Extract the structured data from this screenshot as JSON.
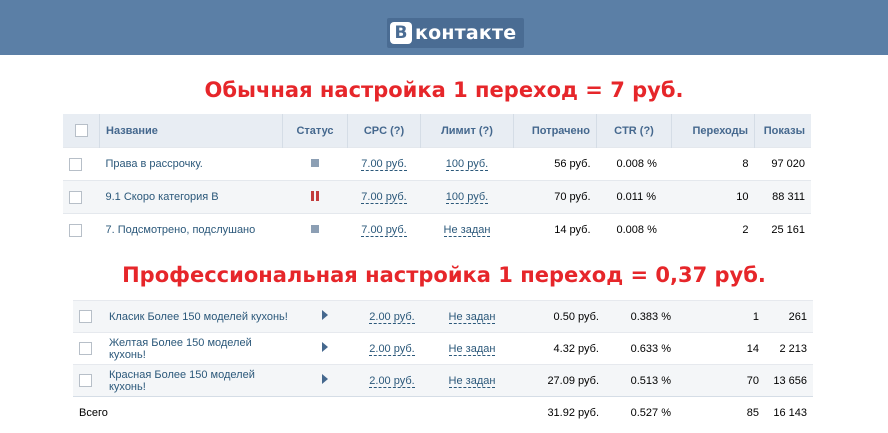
{
  "header": {
    "logo_mark": "В",
    "logo_text": "контакте"
  },
  "captions": {
    "first": "Обычная настройка 1 переход  =  7 руб.",
    "second": "Профессиональная настройка 1 переход = 0,37 руб."
  },
  "table1": {
    "columns": [
      "Название",
      "Статус",
      "CPC (?)",
      "Лимит (?)",
      "Потрачено",
      "CTR (?)",
      "Переходы",
      "Показы"
    ],
    "rows": [
      {
        "name": "Права в рассрочку.",
        "status": "stopped",
        "cpc": "7.00 руб.",
        "limit": "100 руб.",
        "spent": "56 руб.",
        "ctr": "0.008 %",
        "clicks": "8",
        "views": "97 020"
      },
      {
        "name": "9.1 Скоро категория В",
        "status": "paused",
        "cpc": "7.00 руб.",
        "limit": "100 руб.",
        "spent": "70 руб.",
        "ctr": "0.011 %",
        "clicks": "10",
        "views": "88 311"
      },
      {
        "name": "7. Подсмотрено, подслушано",
        "status": "stopped",
        "cpc": "7.00 руб.",
        "limit": "Не задан",
        "spent": "14 руб.",
        "ctr": "0.008 %",
        "clicks": "2",
        "views": "25 161"
      }
    ]
  },
  "table2": {
    "rows": [
      {
        "name": "Класик Более 150 моделей кухонь!",
        "cpc": "2.00 руб.",
        "limit": "Не задан",
        "spent": "0.50 руб.",
        "ctr": "0.383 %",
        "clicks": "1",
        "views": "261"
      },
      {
        "name": "Желтая Более 150 моделей кухонь!",
        "cpc": "2.00 руб.",
        "limit": "Не задан",
        "spent": "4.32 руб.",
        "ctr": "0.633 %",
        "clicks": "14",
        "views": "2 213"
      },
      {
        "name": "Красная Более 150 моделей кухонь!",
        "cpc": "2.00 руб.",
        "limit": "Не задан",
        "spent": "27.09 руб.",
        "ctr": "0.513 %",
        "clicks": "70",
        "views": "13 656"
      }
    ],
    "total": {
      "label": "Всего",
      "spent": "31.92 руб.",
      "ctr": "0.527 %",
      "clicks": "85",
      "views": "16 143"
    }
  }
}
